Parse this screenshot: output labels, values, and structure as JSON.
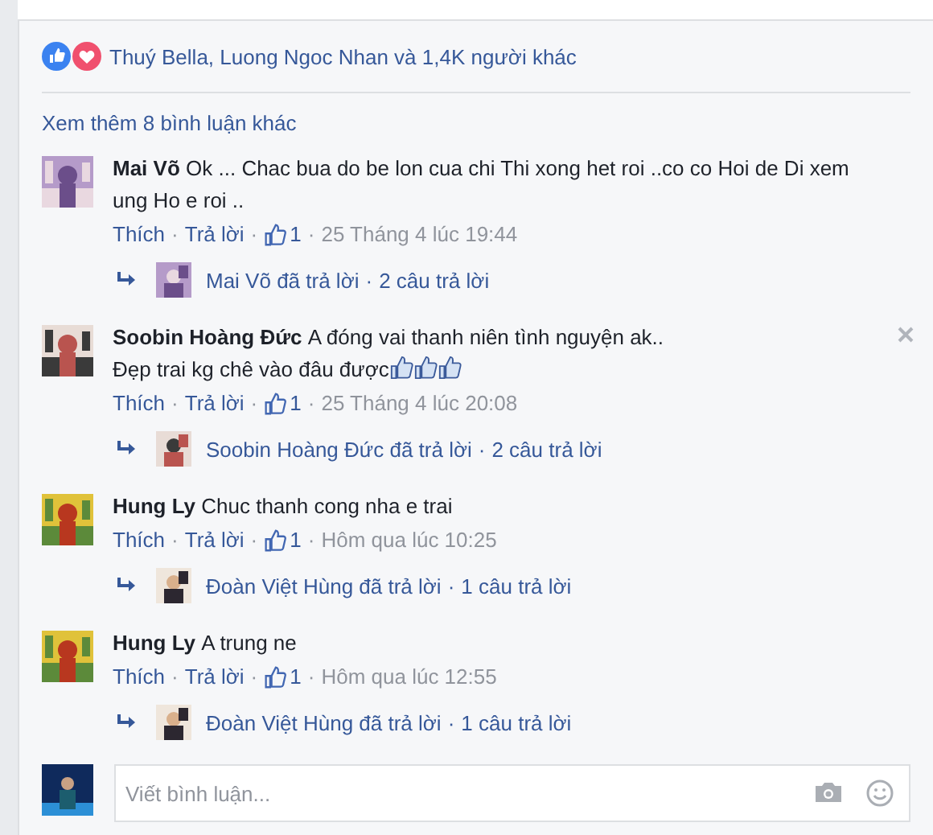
{
  "reactions": {
    "text": "Thuý Bella, Luong Ngoc Nhan và 1,4K người khác"
  },
  "more_comments": "Xem thêm 8 bình luận khác",
  "separator": "·",
  "comments": [
    {
      "author": "Mai Võ",
      "lines": [
        "Ok ... Chac bua do be lon cua chi Thi xong het roi ..co co Hoi de Di xem ung Ho e roi .."
      ],
      "closable": false,
      "actions": [
        "Thích",
        "Trả lời"
      ],
      "likes": "1",
      "time": "25 Tháng 4 lúc 19:44",
      "reply": {
        "who": "Mai Võ đã trả lời",
        "count": "2 câu trả lời"
      }
    },
    {
      "author": "Soobin Hoàng Đức",
      "lines": [
        "A đóng vai thanh niên tình nguyện ak..",
        "Đẹp trai kg chê vào đâu được"
      ],
      "emoji": [
        {
          "kind": "thumbs-up"
        },
        {
          "kind": "thumbs-up"
        },
        {
          "kind": "thumbs-up"
        }
      ],
      "closable": true,
      "actions": [
        "Thích",
        "Trả lời"
      ],
      "likes": "1",
      "time": "25 Tháng 4 lúc 20:08",
      "reply": {
        "who": "Soobin Hoàng Đức đã trả lời",
        "count": "2 câu trả lời"
      }
    },
    {
      "author": "Hung Ly",
      "lines": [
        "Chuc thanh cong nha e trai"
      ],
      "closable": false,
      "actions": [
        "Thích",
        "Trả lời"
      ],
      "likes": "1",
      "time": "Hôm qua lúc 10:25",
      "reply": {
        "who": "Đoàn Việt Hùng đã trả lời",
        "count": "1 câu trả lời"
      }
    },
    {
      "author": "Hung Ly",
      "lines": [
        "A trung ne"
      ],
      "closable": false,
      "actions": [
        "Thích",
        "Trả lời"
      ],
      "likes": "1",
      "time": "Hôm qua lúc 12:55",
      "reply": {
        "who": "Đoàn Việt Hùng đã trả lời",
        "count": "1 câu trả lời"
      }
    }
  ],
  "composer": {
    "placeholder": "Viết bình luận..."
  }
}
